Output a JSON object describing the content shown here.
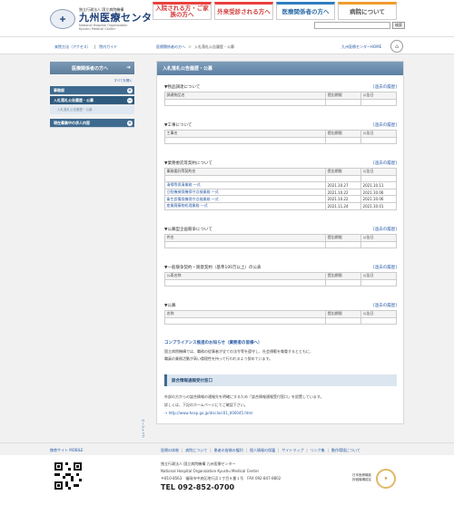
{
  "header": {
    "logo_org": "独立行政法人 国立病院機構",
    "logo_name": "九州医療センター",
    "logo_en1": "National Hospital Organization",
    "logo_en2": "Kyushu Medical Center",
    "nav": [
      {
        "label": "入院される方・ご家族の方へ"
      },
      {
        "label": "外来受診される方へ"
      },
      {
        "label": "医療関係者の方へ"
      },
      {
        "label": "病院について"
      }
    ],
    "search_placeholder": "",
    "search_button": "検索"
  },
  "subbar": {
    "quicklinks": [
      "来院方法（アクセス）",
      "院内ガイド"
    ],
    "breadcrumb": [
      "医療関係者の方へ",
      "＞",
      "入札落札公告履歴・公募"
    ],
    "home_link": "九州医療センターHOME"
  },
  "sidebar": {
    "heading": "医療関係者の方へ",
    "open_all": "すべてを開く",
    "items": [
      {
        "label": "事務部"
      },
      {
        "label": "入札落札公告履歴・公募"
      },
      {
        "label": "入札落札公告履歴・公募"
      },
      {
        "label": "現在募集中の求人内容"
      }
    ],
    "page_top": "ページトップ"
  },
  "main": {
    "title": "入札落札公告履歴・公募",
    "sections": [
      {
        "title": "▼物品調達について",
        "link": "[過去の履歴]",
        "headers": [
          "調達物品名",
          "提出期限",
          "公告日"
        ],
        "rows": [
          [
            "",
            "",
            ""
          ]
        ]
      },
      {
        "title": "▼工事について",
        "link": "[過去の履歴]",
        "headers": [
          "工事名",
          "提出期限",
          "公告日"
        ],
        "rows": [
          [
            "",
            "",
            ""
          ]
        ]
      },
      {
        "title": "▼業務委託等契約について",
        "link": "[過去の履歴]",
        "headers": [
          "業務委託等契約名",
          "提出期限",
          "公告日"
        ],
        "rows": [
          [
            "",
            "",
            ""
          ],
          [
            "清掃等保清業務 一式",
            "2021.10.27",
            "2021.10.11"
          ],
          [
            "立駐機械保機保守点検業務 一式",
            "2021.10.22",
            "2021.10.06"
          ],
          [
            "衛生設備保機保守点検業務 一式",
            "2021.10.22",
            "2021.10.06"
          ],
          [
            "産業廃棄物処理業務 一式",
            "2021.11.24",
            "2021.10.01"
          ]
        ]
      },
      {
        "title": "▼公募型企画競争について",
        "link": "[過去の履歴]",
        "headers": [
          "件名",
          "提出期限",
          "公告日"
        ],
        "rows": [
          [
            "",
            "",
            ""
          ]
        ]
      },
      {
        "title": "▼一般競争契約・随意契約（基準100万以上）の公表",
        "link": "[過去の履歴]",
        "headers": [
          "公表名称",
          "提出期限",
          "公告日"
        ],
        "rows": [
          [
            "",
            "",
            ""
          ]
        ]
      },
      {
        "title": "▼公募",
        "link": "[過去の履歴]",
        "headers": [
          "名称",
          "提出期限",
          "公告日"
        ],
        "rows": [
          [
            "",
            "",
            ""
          ]
        ]
      }
    ],
    "compliance": {
      "title": "コンプライアンス推進のお知らせ（業務者の皆様へ）",
      "body1": "国立病院機構では、職務の従事者が全ての法令等を遵守し、社会規範を尊重するとともに、",
      "body2": "職員の業務活動が高い倫理性を持って行われるよう努めています。"
    },
    "report": {
      "title": "談合情報通報受付窓口",
      "line1": "外部の方からの談合情報の通報先を明確にするため「談合情報通報受付窓口」を設置しています。",
      "line2": "詳しくは、下記のホームページにてご確認下さい。",
      "url": "→ http://www.hosp.go.jp/disclo/c01_000045.html"
    }
  },
  "footer": {
    "mobile_link": "携帯サイト MOBILE",
    "nav": [
      "医療の体制",
      "病院について",
      "患者の皆様の権利",
      "個人情報の保護",
      "サイトマップ",
      "リンク集",
      "動作環境について"
    ],
    "org": "独立行政法人 国立病院機構 九州医療センター",
    "org_en": "National Hospital Organization Kyushu Medical Center",
    "address": "〒810-8563　福岡市中央区地行浜１丁目８番１号　FAX 092-847-8802",
    "tel": "TEL 092-852-0700",
    "jqhc1": "日本医療機能",
    "jqhc2": "評価機構認定"
  },
  "colors": {
    "accent_red": "#e8423f",
    "accent_blue": "#2f7ec1",
    "accent_orange": "#f29b2c",
    "nav_dark": "#3e6a8f",
    "link": "#2a5da8"
  },
  "icons": [
    "logo-icon",
    "home-icon",
    "arrow-right-icon",
    "plus-icon",
    "qr-code",
    "accreditation-mark"
  ]
}
